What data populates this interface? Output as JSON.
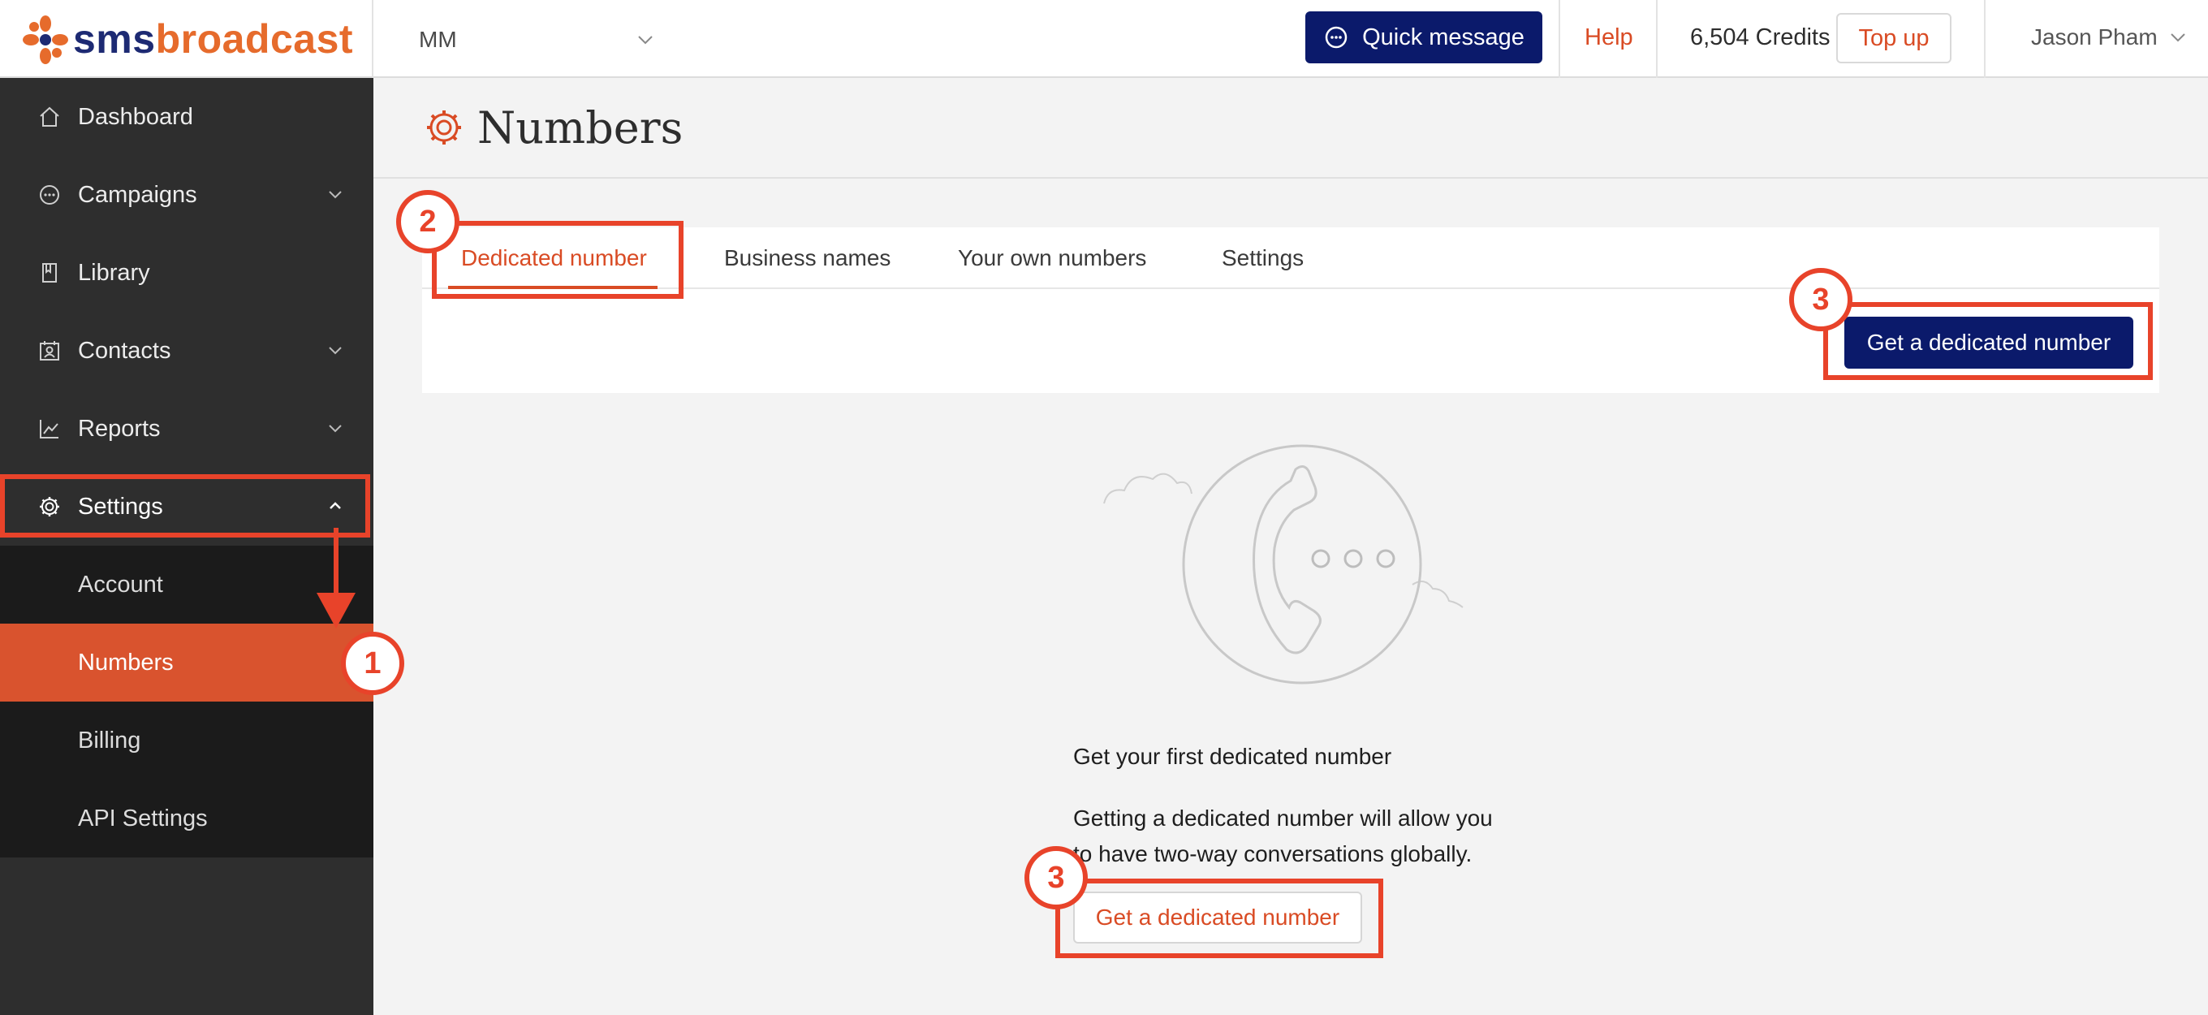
{
  "brand": {
    "logo_sms": "sms",
    "logo_broadcast": "broadcast",
    "colors": {
      "navy": "#0b1a6b",
      "orange": "#e66b2c",
      "accent": "#d94b24",
      "annotation": "#e8432a"
    }
  },
  "topbar": {
    "account": "MM",
    "quick_message": "Quick message",
    "help": "Help",
    "credits": "6,504 Credits",
    "topup": "Top up",
    "user": "Jason Pham"
  },
  "sidebar": {
    "items": [
      {
        "label": "Dashboard",
        "icon": "home-icon"
      },
      {
        "label": "Campaigns",
        "icon": "chat-icon"
      },
      {
        "label": "Library",
        "icon": "book-icon"
      },
      {
        "label": "Contacts",
        "icon": "contacts-icon"
      },
      {
        "label": "Reports",
        "icon": "chart-icon"
      },
      {
        "label": "Settings",
        "icon": "gear-icon"
      }
    ],
    "settings_submenu": [
      {
        "label": "Account"
      },
      {
        "label": "Numbers"
      },
      {
        "label": "Billing"
      },
      {
        "label": "API Settings"
      }
    ]
  },
  "page": {
    "title": "Numbers",
    "tabs": [
      {
        "label": "Dedicated number"
      },
      {
        "label": "Business names"
      },
      {
        "label": "Your own numbers"
      },
      {
        "label": "Settings"
      }
    ],
    "primary_cta": "Get a dedicated number",
    "empty_state": {
      "title": "Get your first dedicated number",
      "description": "Getting a dedicated number will allow you to have two-way conversations globally.",
      "cta": "Get a dedicated number"
    }
  },
  "annotations": {
    "step1": "1",
    "step2": "2",
    "step3a": "3",
    "step3b": "3"
  }
}
